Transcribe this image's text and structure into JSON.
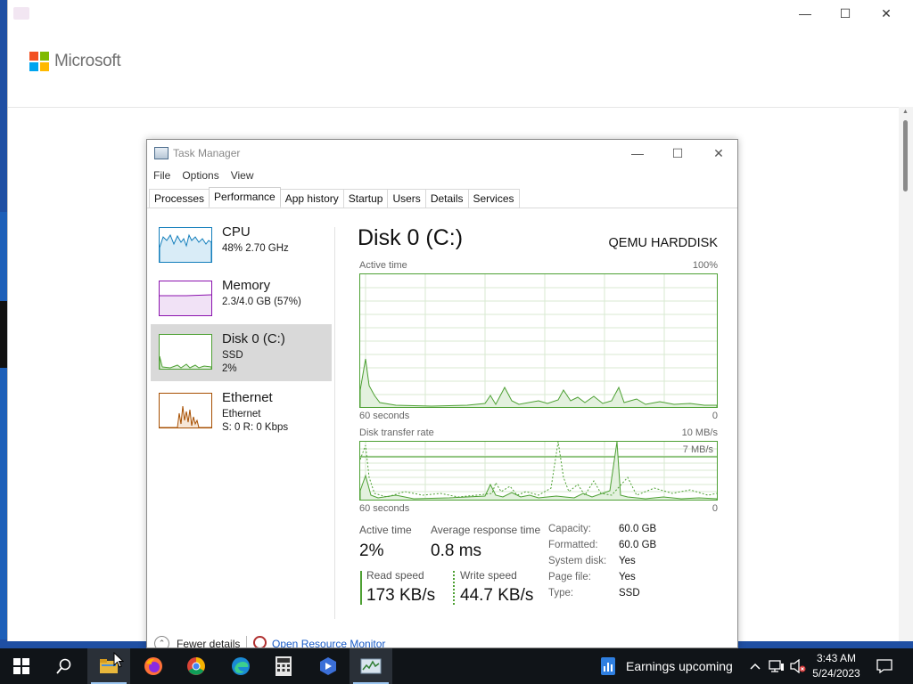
{
  "background_page": {
    "brand_text": "Microsoft",
    "brand_colors": [
      "#f25022",
      "#7fba00",
      "#00a4ef",
      "#ffb900"
    ]
  },
  "task_manager": {
    "title": "Task Manager",
    "window_controls": {
      "minimize": "—",
      "maximize": "☐",
      "close": "✕"
    },
    "menu": [
      "File",
      "Options",
      "View"
    ],
    "tabs": [
      "Processes",
      "Performance",
      "App history",
      "Startup",
      "Users",
      "Details",
      "Services"
    ],
    "active_tab": "Performance",
    "resources": [
      {
        "name": "CPU",
        "line1": "48%  2.70 GHz",
        "line2": "",
        "line3": "",
        "color": "#117dbb"
      },
      {
        "name": "Memory",
        "line1": "2.3/4.0 GB (57%)",
        "line2": "",
        "line3": "",
        "color": "#8b12ae"
      },
      {
        "name": "Disk 0 (C:)",
        "line1": "SSD",
        "line2": "2%",
        "line3": "",
        "color": "#4da033"
      },
      {
        "name": "Ethernet",
        "line1": "Ethernet",
        "line2": "S: 0  R: 0 Kbps",
        "line3": "",
        "color": "#a74f01"
      }
    ],
    "detail": {
      "title": "Disk 0 (C:)",
      "model": "QEMU HARDDISK",
      "active_time_graph": {
        "label": "Active time",
        "max_label": "100%",
        "time_label": "60 seconds",
        "min_label": "0"
      },
      "transfer_graph": {
        "label": "Disk transfer rate",
        "max_label": "10 MB/s",
        "inner_label": "7 MB/s",
        "time_label": "60 seconds",
        "min_label": "0"
      },
      "active_time_label": "Active time",
      "active_time_value": "2%",
      "avg_response_label": "Average response time",
      "avg_response_value": "0.8 ms",
      "read_label": "Read speed",
      "read_value": "173 KB/s",
      "write_label": "Write speed",
      "write_value": "44.7 KB/s",
      "properties": [
        {
          "label": "Capacity:",
          "value": "60.0 GB"
        },
        {
          "label": "Formatted:",
          "value": "60.0 GB"
        },
        {
          "label": "System disk:",
          "value": "Yes"
        },
        {
          "label": "Page file:",
          "value": "Yes"
        },
        {
          "label": "Type:",
          "value": "SSD"
        }
      ]
    },
    "footer": {
      "fewer_details": "Fewer details",
      "resource_monitor": "Open Resource Monitor"
    }
  },
  "taskbar": {
    "news_text": "Earnings upcoming",
    "time": "3:43 AM",
    "date": "5/24/2023",
    "pinned": [
      "start-icon",
      "search-icon",
      "file-explorer-icon",
      "firefox-icon",
      "chrome-icon",
      "edge-icon",
      "calculator-icon",
      "remote-desktop-icon",
      "task-manager-icon"
    ]
  }
}
